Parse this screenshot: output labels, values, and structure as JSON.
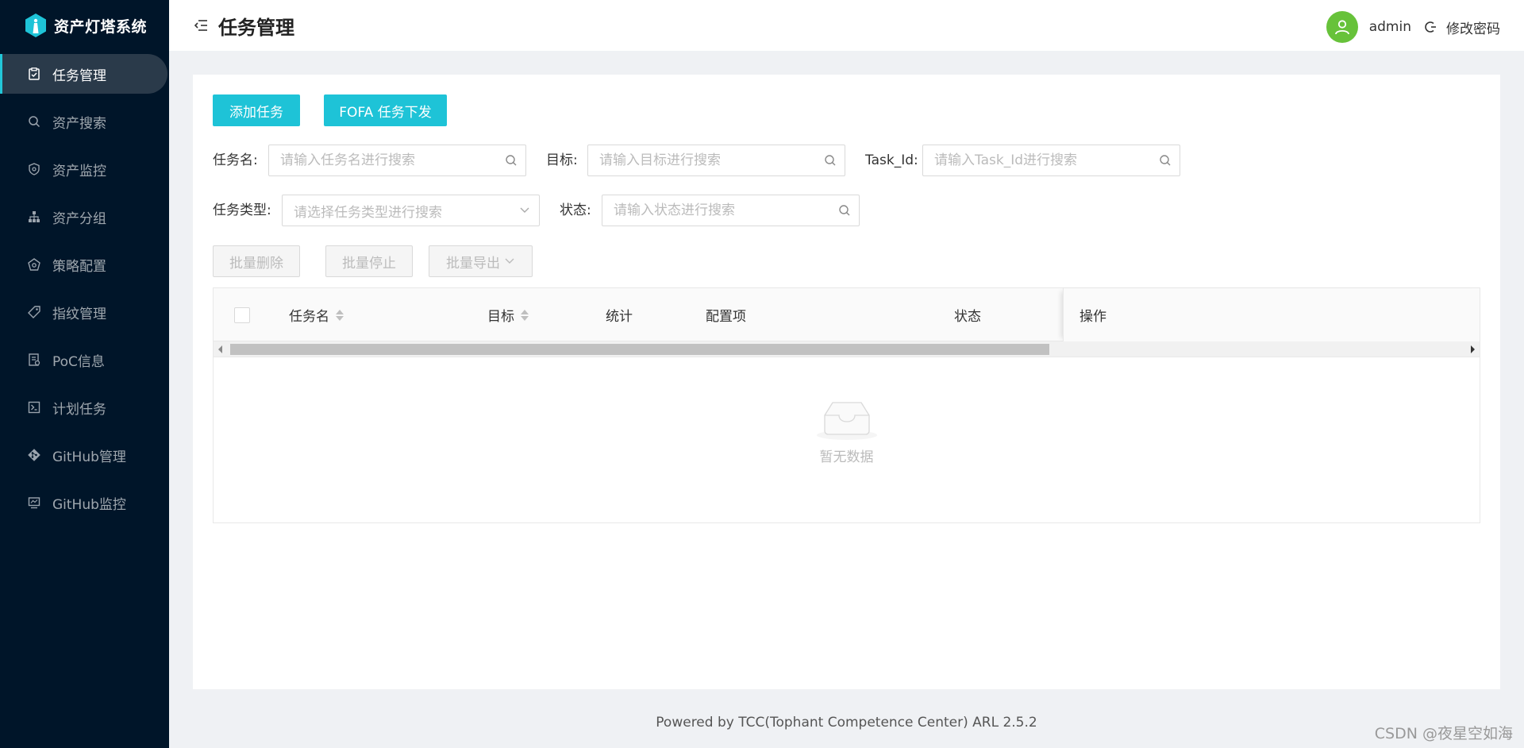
{
  "app": {
    "name": "资产灯塔系统"
  },
  "sidebar": {
    "items": [
      {
        "label": "任务管理",
        "icon": "task-icon",
        "active": true
      },
      {
        "label": "资产搜索",
        "icon": "search-icon",
        "active": false
      },
      {
        "label": "资产监控",
        "icon": "shield-icon",
        "active": false
      },
      {
        "label": "资产分组",
        "icon": "cluster-icon",
        "active": false
      },
      {
        "label": "策略配置",
        "icon": "policy-icon",
        "active": false
      },
      {
        "label": "指纹管理",
        "icon": "tag-icon",
        "active": false
      },
      {
        "label": "PoC信息",
        "icon": "file-icon",
        "active": false
      },
      {
        "label": "计划任务",
        "icon": "terminal-icon",
        "active": false
      },
      {
        "label": "GitHub管理",
        "icon": "git-icon",
        "active": false
      },
      {
        "label": "GitHub监控",
        "icon": "monitor-icon",
        "active": false
      }
    ]
  },
  "header": {
    "title": "任务管理",
    "username": "admin",
    "change_password": "修改密码"
  },
  "toolbar": {
    "add_task": "添加任务",
    "fofa_task": "FOFA 任务下发"
  },
  "filters": {
    "task_name_label": "任务名:",
    "task_name_placeholder": "请输入任务名进行搜索",
    "target_label": "目标:",
    "target_placeholder": "请输入目标进行搜索",
    "task_id_label": "Task_Id:",
    "task_id_placeholder": "请输入Task_Id进行搜索",
    "task_type_label": "任务类型:",
    "task_type_placeholder": "请选择任务类型进行搜索",
    "status_label": "状态:",
    "status_placeholder": "请输入状态进行搜索"
  },
  "batch": {
    "delete": "批量删除",
    "stop": "批量停止",
    "export": "批量导出"
  },
  "table": {
    "columns": {
      "task_name": "任务名",
      "target": "目标",
      "stats": "统计",
      "config": "配置项",
      "status": "状态",
      "actions": "操作"
    },
    "empty_text": "暂无数据"
  },
  "footer": {
    "text": "Powered by TCC(Tophant Competence Center) ARL 2.5.2"
  },
  "watermark": "CSDN @夜星空如海",
  "colors": {
    "sidebar_bg": "#001529",
    "accent": "#1ec3d7",
    "avatar": "#67c23a"
  }
}
